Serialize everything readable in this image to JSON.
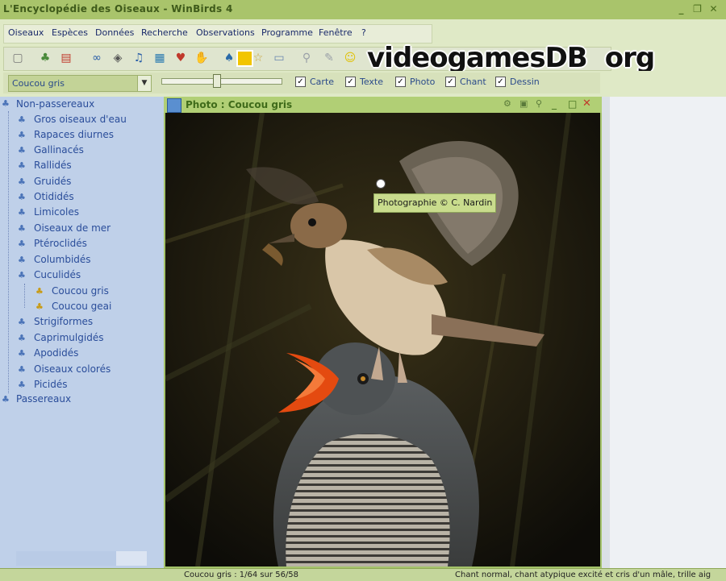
{
  "window": {
    "title": "L'Encyclopédie des Oiseaux - WinBirds 4"
  },
  "menu": [
    "Oiseaux",
    "Espèces",
    "Données",
    "Recherche",
    "Observations",
    "Programme",
    "Fenêtre",
    "?"
  ],
  "watermark": {
    "text": "videogamesDB",
    "suffix": "org"
  },
  "options": {
    "species_selected": "Coucou gris",
    "slider_level": 0.47,
    "checkboxes": [
      {
        "label": "Carte",
        "checked": true
      },
      {
        "label": "Texte",
        "checked": true
      },
      {
        "label": "Photo",
        "checked": true
      },
      {
        "label": "Chant",
        "checked": true
      },
      {
        "label": "Dessin",
        "checked": true
      }
    ]
  },
  "tree": {
    "root1": "Non-passereaux",
    "items": [
      "Gros oiseaux d'eau",
      "Rapaces diurnes",
      "Gallinacés",
      "Rallidés",
      "Gruidés",
      "Otididés",
      "Limicoles",
      "Oiseaux de mer",
      "Ptéroclidés",
      "Columbidés",
      "Cuculidés"
    ],
    "sub_items": [
      "Coucou gris",
      "Coucou geai"
    ],
    "items_after": [
      "Strigiformes",
      "Caprimulgidés",
      "Apodidés",
      "Oiseaux colorés",
      "Picidés"
    ],
    "root2": "Passereaux"
  },
  "photo_window": {
    "title": "Photo : Coucou gris",
    "caption": "Photographie © C. Nardin"
  },
  "status": {
    "left": "Coucou gris : 1/64 sur 56/58",
    "right": "Chant normal, chant atypique excité et cris d'un mâle, trille aig"
  },
  "colors": {
    "accent": "#a9c46b",
    "tree_bg": "#bfd0e9",
    "tree_text": "#2a4d9a"
  },
  "icons": [
    "grid-icon",
    "bird-icon",
    "open-book-icon",
    "binoculars-icon",
    "eraser-icon",
    "music-note-icon",
    "map-icon",
    "heart-icon",
    "hand-icon",
    "tree-icon",
    "star-icon",
    "folder-icon",
    "pin-icon",
    "edit-icon",
    "help-icon"
  ]
}
